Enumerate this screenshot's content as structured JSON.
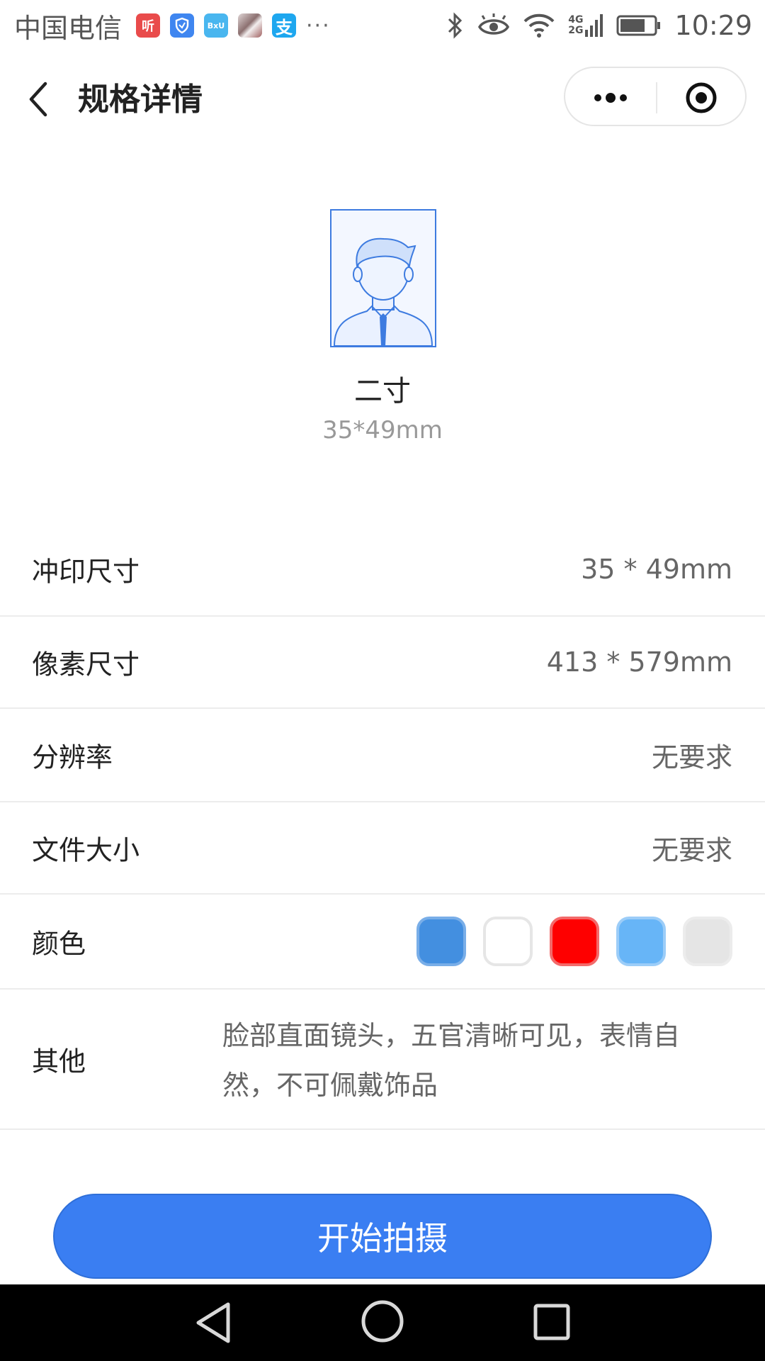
{
  "status_bar": {
    "carrier": "中国电信",
    "apps": [
      {
        "icon": "ting-app-icon",
        "label": "听",
        "color": "#e94b4b"
      },
      {
        "icon": "shield-app-icon",
        "label": "",
        "color": "#3f86f0"
      },
      {
        "icon": "bxu-app-icon",
        "label": "BxU",
        "color": "#49b6ef"
      },
      {
        "icon": "photo-app-icon",
        "label": "",
        "color": "#b9a3a3"
      },
      {
        "icon": "alipay-app-icon",
        "label": "支",
        "color": "#1ea7ef"
      }
    ],
    "more": "···",
    "network_top": "4G",
    "network_bottom": "2G",
    "time": "10:29"
  },
  "nav": {
    "title": "规格详情"
  },
  "spec": {
    "name": "二寸",
    "dims": "35*49mm"
  },
  "rows": {
    "print_size": {
      "label": "冲印尺寸",
      "value": "35 * 49mm"
    },
    "pixel_size": {
      "label": "像素尺寸",
      "value": "413 * 579mm"
    },
    "resolution": {
      "label": "分辨率",
      "value": "无要求"
    },
    "file_size": {
      "label": "文件大小",
      "value": "无要求"
    },
    "color": {
      "label": "颜色",
      "swatches": [
        {
          "name": "blue",
          "color": "#438fe0"
        },
        {
          "name": "white",
          "color": "#ffffff"
        },
        {
          "name": "red",
          "color": "#fe0000"
        },
        {
          "name": "light-blue",
          "color": "#67b5f7"
        },
        {
          "name": "light-gray",
          "color": "#e5e5e5"
        }
      ]
    },
    "other": {
      "label": "其他",
      "value": "脸部直面镜头，五官清晰可见，表情自然，不可佩戴饰品"
    }
  },
  "start_button": {
    "label": "开始拍摄"
  },
  "colors": {
    "accent": "#3a7ef2",
    "card_border": "#3d7be0"
  }
}
